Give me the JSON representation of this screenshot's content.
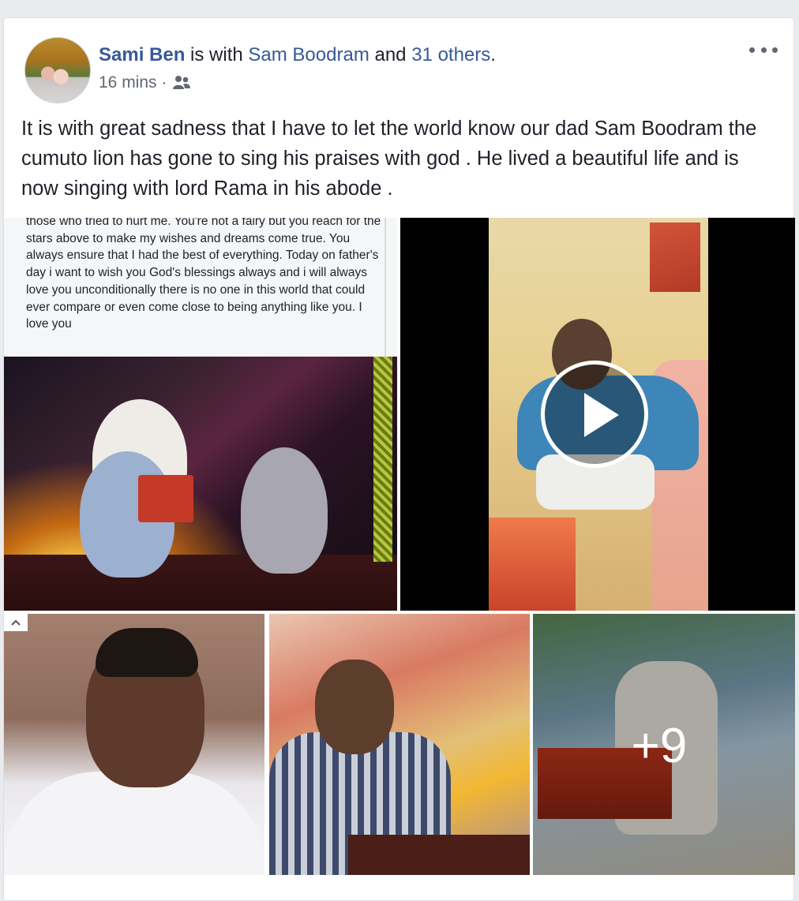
{
  "post": {
    "author": "Sami Ben",
    "is_with_text": "is with",
    "tagged_person": "Sam Boodram",
    "and_text": "and",
    "others_link": "31 others",
    "period": ".",
    "timestamp": "16 mins",
    "separator": "·",
    "audience_icon": "friends-icon",
    "body_text": "It is with great sadness that I have to let the world know our dad Sam Boodram the cumuto lion has gone to sing his praises with god . He lived a beautiful life and is now singing with lord Rama in his abode ."
  },
  "photos": {
    "screenshot_text": "those who tried to hurt me. You're not a fairy but you reach for the stars above to make my wishes and dreams come true. You always ensure that I had the best of everything. Today on father's day i want to wish you God's blessings always and i will always love you unconditionally there is no one in this world that could ever compare or even come close to being anything like you. I love you",
    "more_count": "+9"
  },
  "icons": {
    "more": "more-options-icon",
    "play": "play-icon",
    "caret": "chevron-up-icon"
  },
  "colors": {
    "link": "#385898",
    "text": "#1d2129",
    "meta": "#606770",
    "background": "#e9ebee"
  }
}
